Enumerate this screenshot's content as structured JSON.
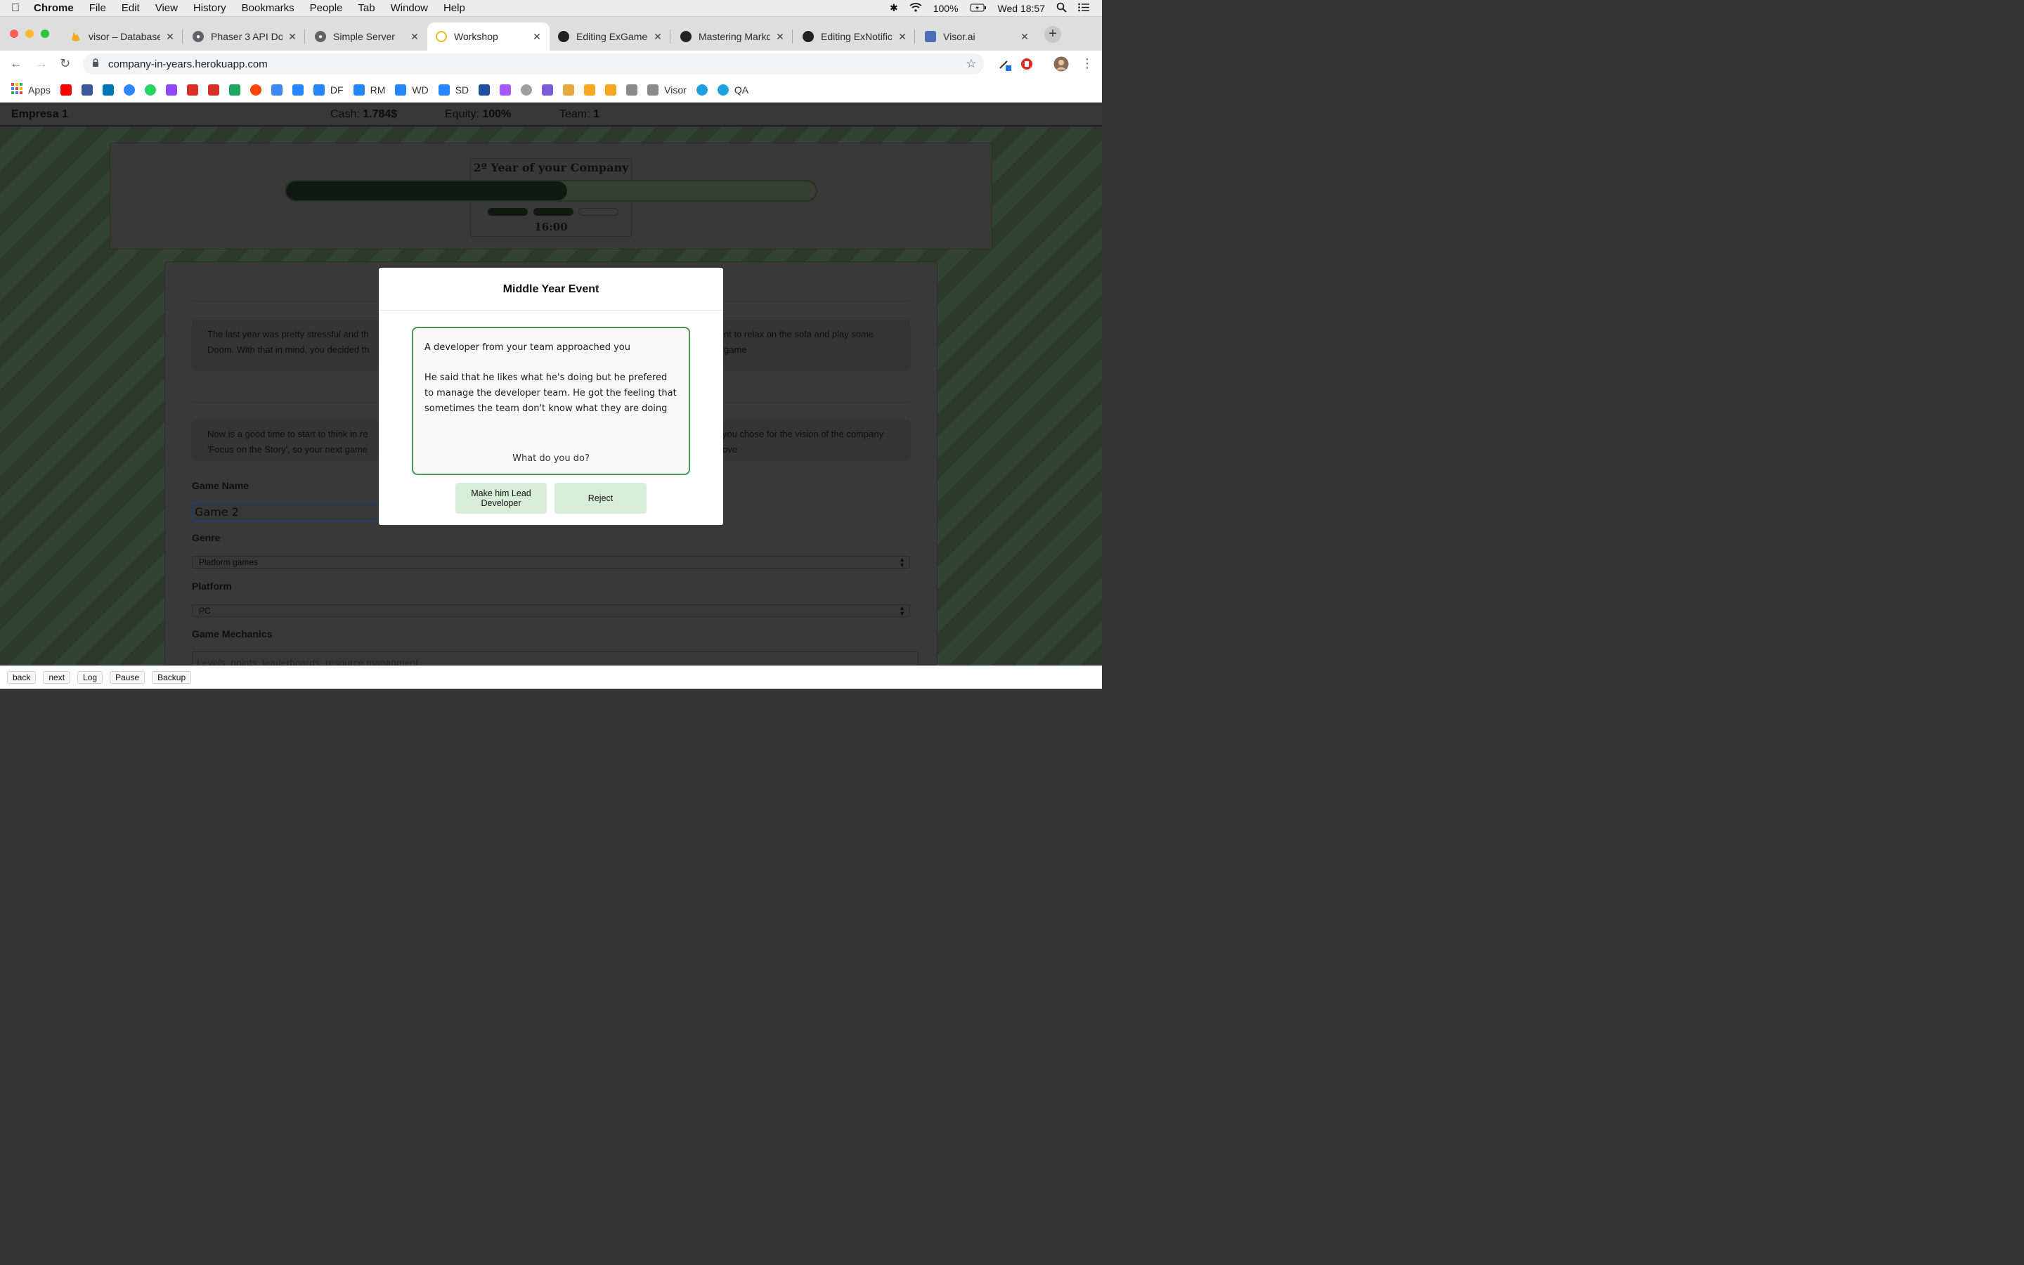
{
  "menubar": {
    "app": "Chrome",
    "items": [
      "File",
      "Edit",
      "View",
      "History",
      "Bookmarks",
      "People",
      "Tab",
      "Window",
      "Help"
    ],
    "battery": "100%",
    "clock": "Wed 18:57"
  },
  "tabs": [
    {
      "title": "visor – Database",
      "icon": "firebase-icon",
      "color": "#f5a623"
    },
    {
      "title": "Phaser 3 API Doc",
      "icon": "globe-icon",
      "color": "#5f6368"
    },
    {
      "title": "Simple Server",
      "icon": "globe-icon",
      "color": "#5f6368"
    },
    {
      "title": "Workshop",
      "icon": "loading-icon",
      "color": "#e8b730",
      "active": true
    },
    {
      "title": "Editing ExGameC",
      "icon": "github-icon",
      "color": "#222222"
    },
    {
      "title": "Mastering Markd",
      "icon": "github-icon",
      "color": "#222222"
    },
    {
      "title": "Editing ExNotific",
      "icon": "github-icon",
      "color": "#222222"
    },
    {
      "title": "Visor.ai",
      "icon": "robot-icon",
      "color": "#4a6fb5"
    }
  ],
  "address": {
    "url": "company-in-years.herokuapp.com"
  },
  "bookmarks": [
    {
      "label": "Apps",
      "icon": "apps-grid-icon",
      "color": "#e0463a"
    },
    {
      "label": "",
      "icon": "youtube-icon",
      "color": "#ff0000"
    },
    {
      "label": "",
      "icon": "facebook-icon",
      "color": "#3b5998"
    },
    {
      "label": "",
      "icon": "linkedin-icon",
      "color": "#0077b5"
    },
    {
      "label": "",
      "icon": "messenger-icon",
      "color": "#2d88ff"
    },
    {
      "label": "",
      "icon": "whatsapp-icon",
      "color": "#25d366"
    },
    {
      "label": "",
      "icon": "twitch-icon",
      "color": "#9146ff"
    },
    {
      "label": "",
      "icon": "gmail-icon",
      "color": "#d93025"
    },
    {
      "label": "",
      "icon": "gmail-icon",
      "color": "#d93025"
    },
    {
      "label": "",
      "icon": "drive-icon",
      "color": "#1fa463"
    },
    {
      "label": "",
      "icon": "reddit-icon",
      "color": "#ff4500"
    },
    {
      "label": "",
      "icon": "calendar-icon",
      "color": "#4285f4"
    },
    {
      "label": "",
      "icon": "bitbucket-icon",
      "color": "#2684ff"
    },
    {
      "label": "DF",
      "icon": "jira-icon",
      "color": "#2684ff"
    },
    {
      "label": "RM",
      "icon": "jira-icon",
      "color": "#2684ff"
    },
    {
      "label": "WD",
      "icon": "jira-icon",
      "color": "#2684ff"
    },
    {
      "label": "SD",
      "icon": "jira-icon",
      "color": "#2684ff"
    },
    {
      "label": "",
      "icon": "pivotal-icon",
      "color": "#1f4fa1"
    },
    {
      "label": "",
      "icon": "figma-icon",
      "color": "#a259ff"
    },
    {
      "label": "",
      "icon": "loading-c-icon",
      "color": "#9aa0a6"
    },
    {
      "label": "",
      "icon": "discord-icon",
      "color": "#7a5cd6"
    },
    {
      "label": "",
      "icon": "box-icon",
      "color": "#e5a83a"
    },
    {
      "label": "",
      "icon": "firebase-icon",
      "color": "#f5a623"
    },
    {
      "label": "",
      "icon": "firebase-icon",
      "color": "#f5a623"
    },
    {
      "label": "",
      "icon": "folder-icon",
      "color": "#8a8a8a"
    },
    {
      "label": "Visor",
      "icon": "folder-icon",
      "color": "#8a8a8a"
    },
    {
      "label": "",
      "icon": "salesforce-icon",
      "color": "#1fa0e0"
    },
    {
      "label": "QA",
      "icon": "salesforce-icon",
      "color": "#1fa0e0"
    }
  ],
  "game": {
    "company": "Empresa 1",
    "cash_label": "Cash:",
    "cash_value": "1.784$",
    "equity_label": "Equity:",
    "equity_value": "100%",
    "team_label": "Team:",
    "team_value": "1",
    "year_title": "2º Year of your Company",
    "progress": 0.53,
    "segments": [
      true,
      true,
      false
    ],
    "time": "16:00",
    "intro_left_1": "The last year was pretty stressful and th",
    "intro_left_2": "Doom. With that in mind, you decided th",
    "intro_right_1": "nt to relax on the sofa and play some",
    "intro_right_2": "game",
    "vision_left_1": "Now is a good time to start to think in re",
    "vision_left_2": "'Focus on the Story', so your next game",
    "vision_right_1": "you chose for the vision of the company",
    "vision_right_2": "ove",
    "name_label": "Game Name",
    "name_value": "Game 2",
    "genre_label": "Genre",
    "genre_value": "Platform games",
    "platform_label": "Platform",
    "platform_value": "PC",
    "mechanics_label": "Game Mechanics",
    "mechanics_placeholder": "Levels, points, leaderboards, resource managment..."
  },
  "modal": {
    "title": "Middle Year Event",
    "line1": "A developer from your team approached you",
    "line2": "He said that he likes what he's doing but he prefered to manage the developer team. He got the feeling that sometimes the team don't know what they are doing",
    "question": "What do you do?",
    "accept": "Make him Lead Developer",
    "reject": "Reject"
  },
  "debug": {
    "back": "back",
    "next": "next",
    "log": "Log",
    "pause": "Pause",
    "backup": "Backup"
  },
  "colors": {
    "accent_green": "#4b9550",
    "button_green": "#d7edd7",
    "progress_dark": "#101b0f"
  }
}
